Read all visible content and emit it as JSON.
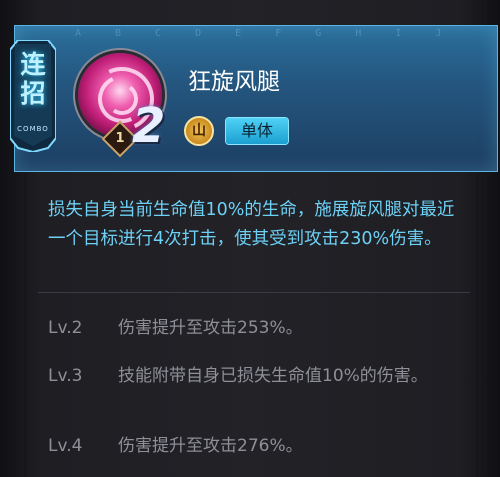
{
  "header": {
    "deco_letters": "A B C D E F G H I J K L M N",
    "combo_label_chars": [
      "连",
      "招"
    ],
    "combo_sub": "COMBO",
    "skill_name": "狂旋风腿",
    "level_badge": "1",
    "cost": "2",
    "element_icon_char": "山",
    "target_type": "单体"
  },
  "description": "损失自身当前生命值10%的生命，施展旋风腿对最近一个目标进行4次打击，使其受到攻击230%伤害。",
  "levels": [
    {
      "tag": "Lv.2",
      "text": "伤害提升至攻击253%。"
    },
    {
      "tag": "Lv.3",
      "text": "技能附带自身已损失生命值10%的伤害。"
    },
    {
      "tag": "Lv.4",
      "text": "伤害提升至攻击276%。"
    }
  ],
  "colors": {
    "accent_blue": "#6dd0f5",
    "level_text": "#8f8f98",
    "badge_cyan": "#4fd2f5",
    "orb_pink": "#e0449a"
  },
  "icons": {
    "skill": "swirl-kick-icon",
    "element": "mountain-element-icon",
    "level": "diamond-level-icon"
  }
}
